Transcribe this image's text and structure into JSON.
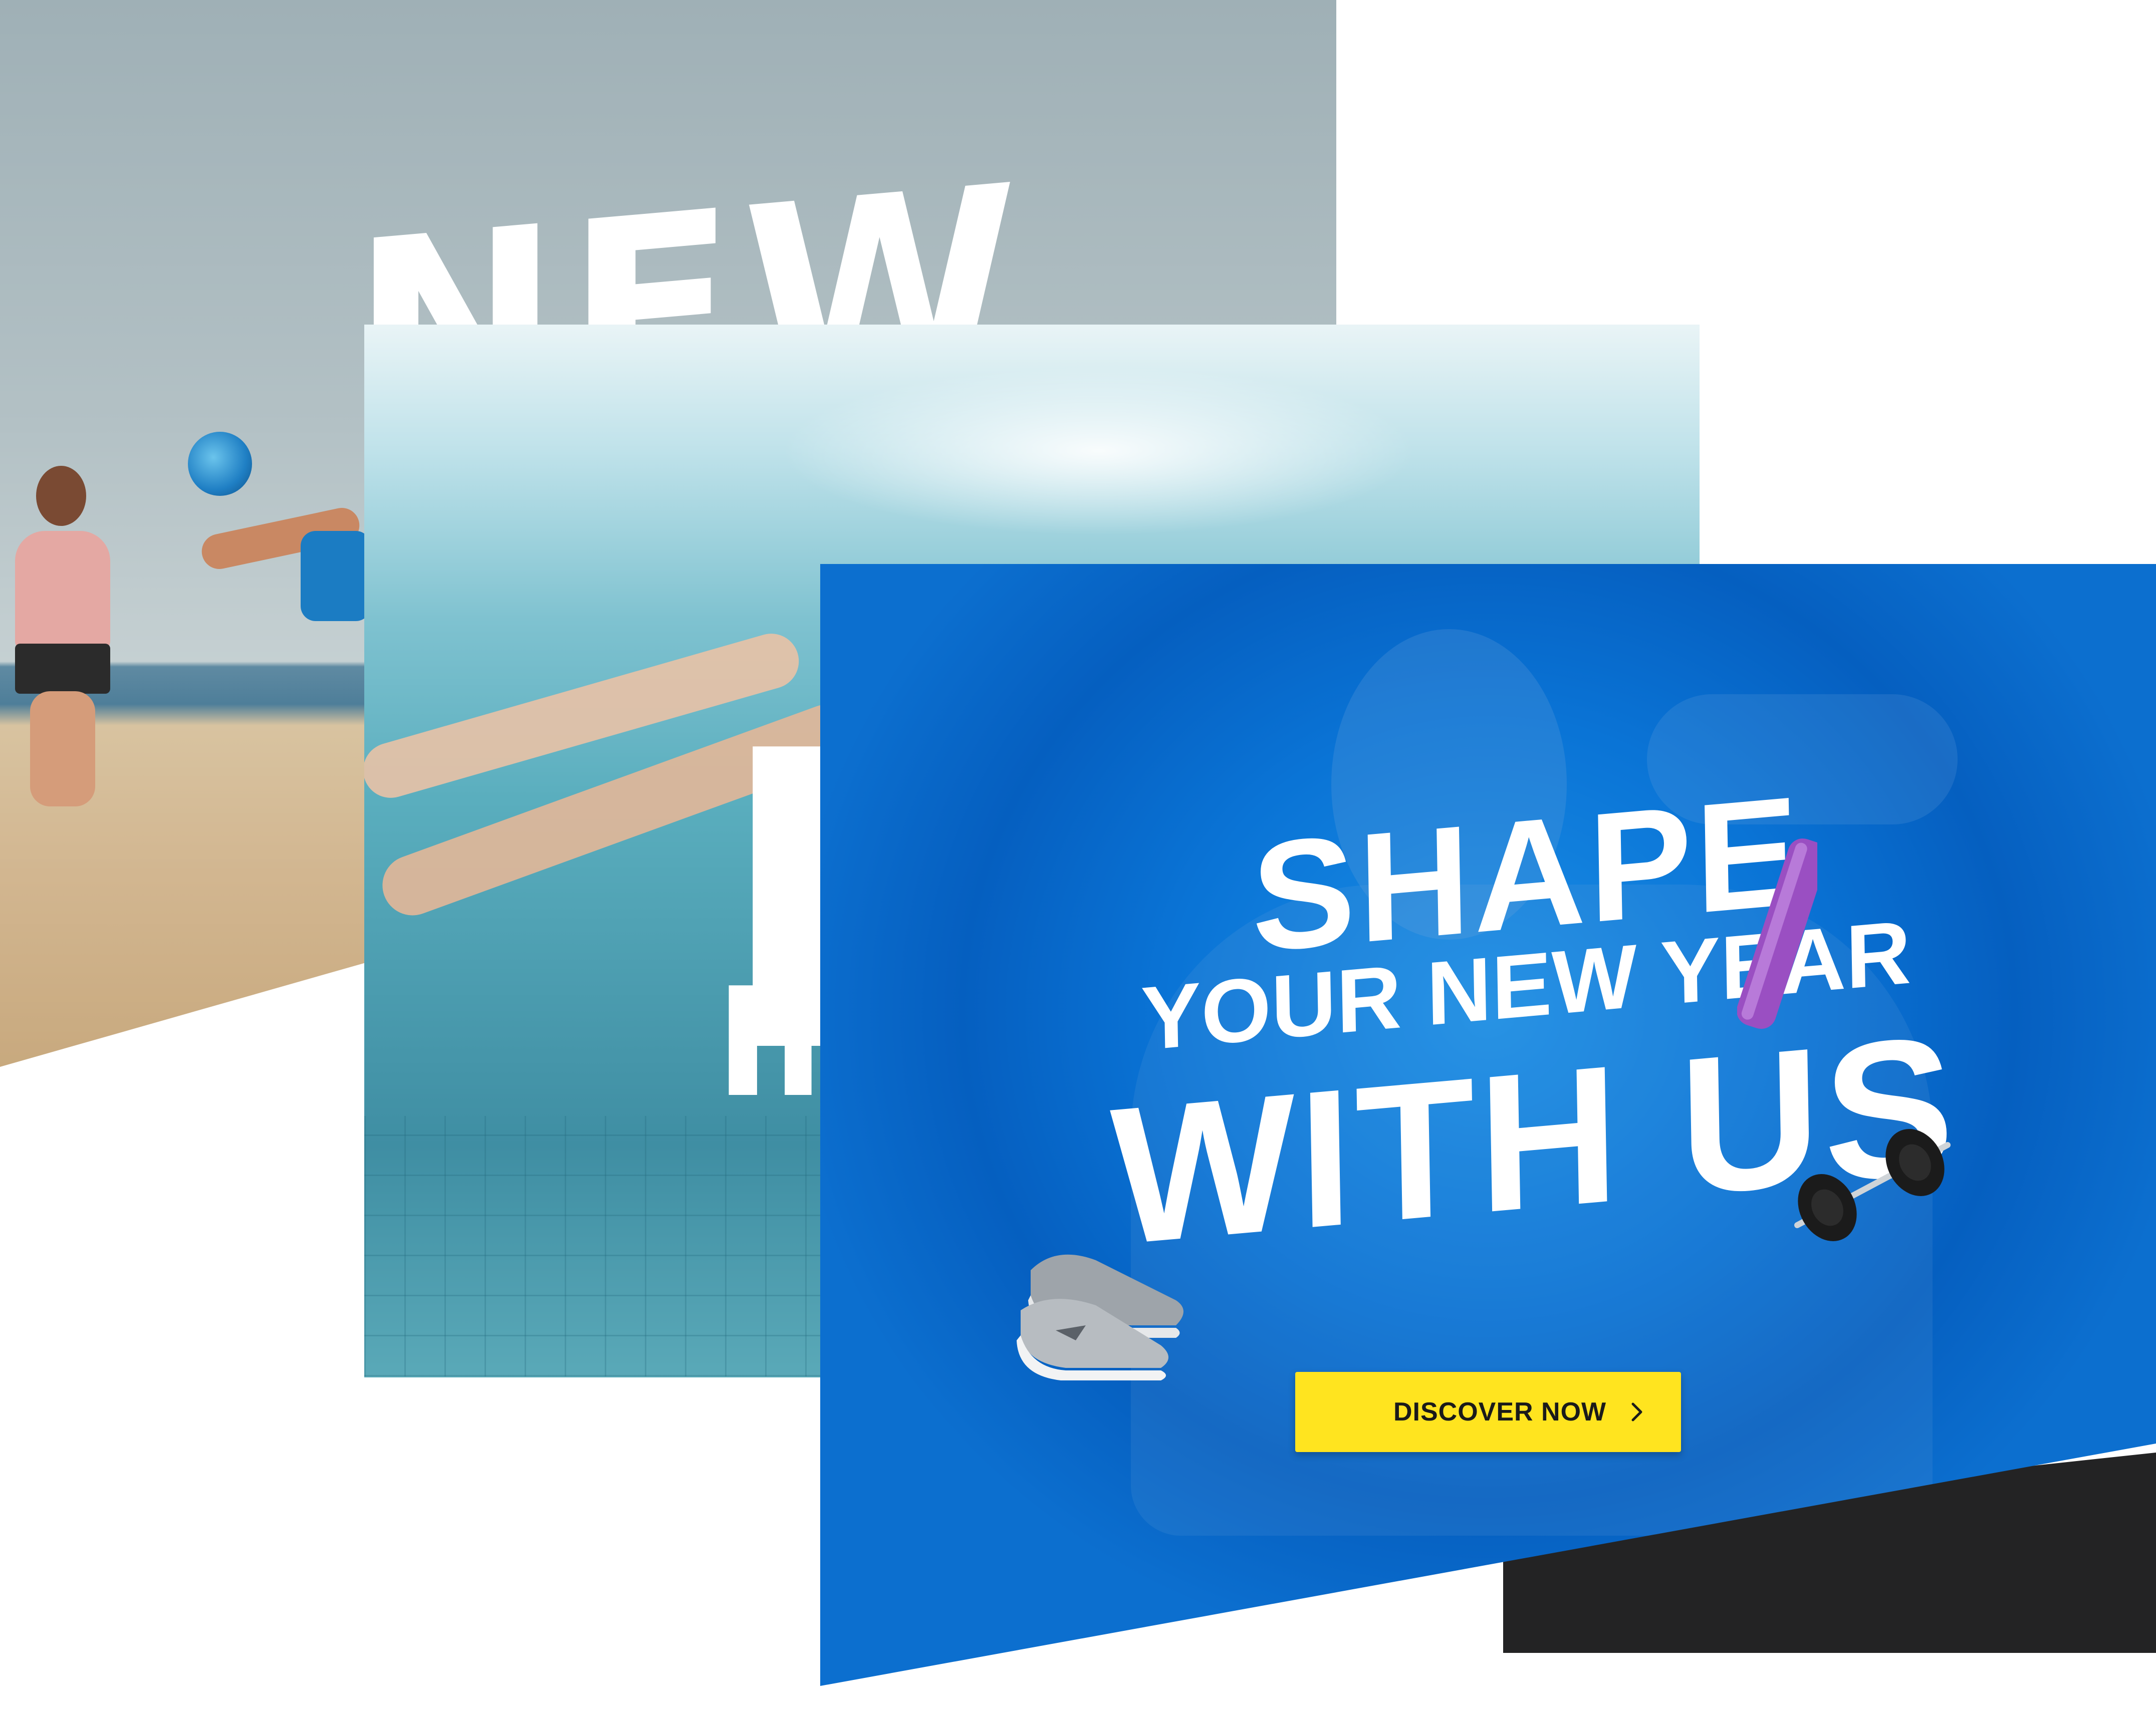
{
  "cards": {
    "beach": {
      "headline": "NEW"
    },
    "pool": {
      "headline": "N",
      "subheadline": "IN"
    },
    "front": {
      "line1": "SHAPE",
      "line2": "YOUR NEW YEAR",
      "line3": "WITH US",
      "cta_label": "DISCOVER NOW",
      "cta_icon": "chevron-right-icon"
    }
  },
  "colors": {
    "front_background": "#0a74d6",
    "cta_background": "#ffe41f",
    "cta_text": "#1a1a1a",
    "mat": "#9a4fc2",
    "shadow": "#232324"
  }
}
